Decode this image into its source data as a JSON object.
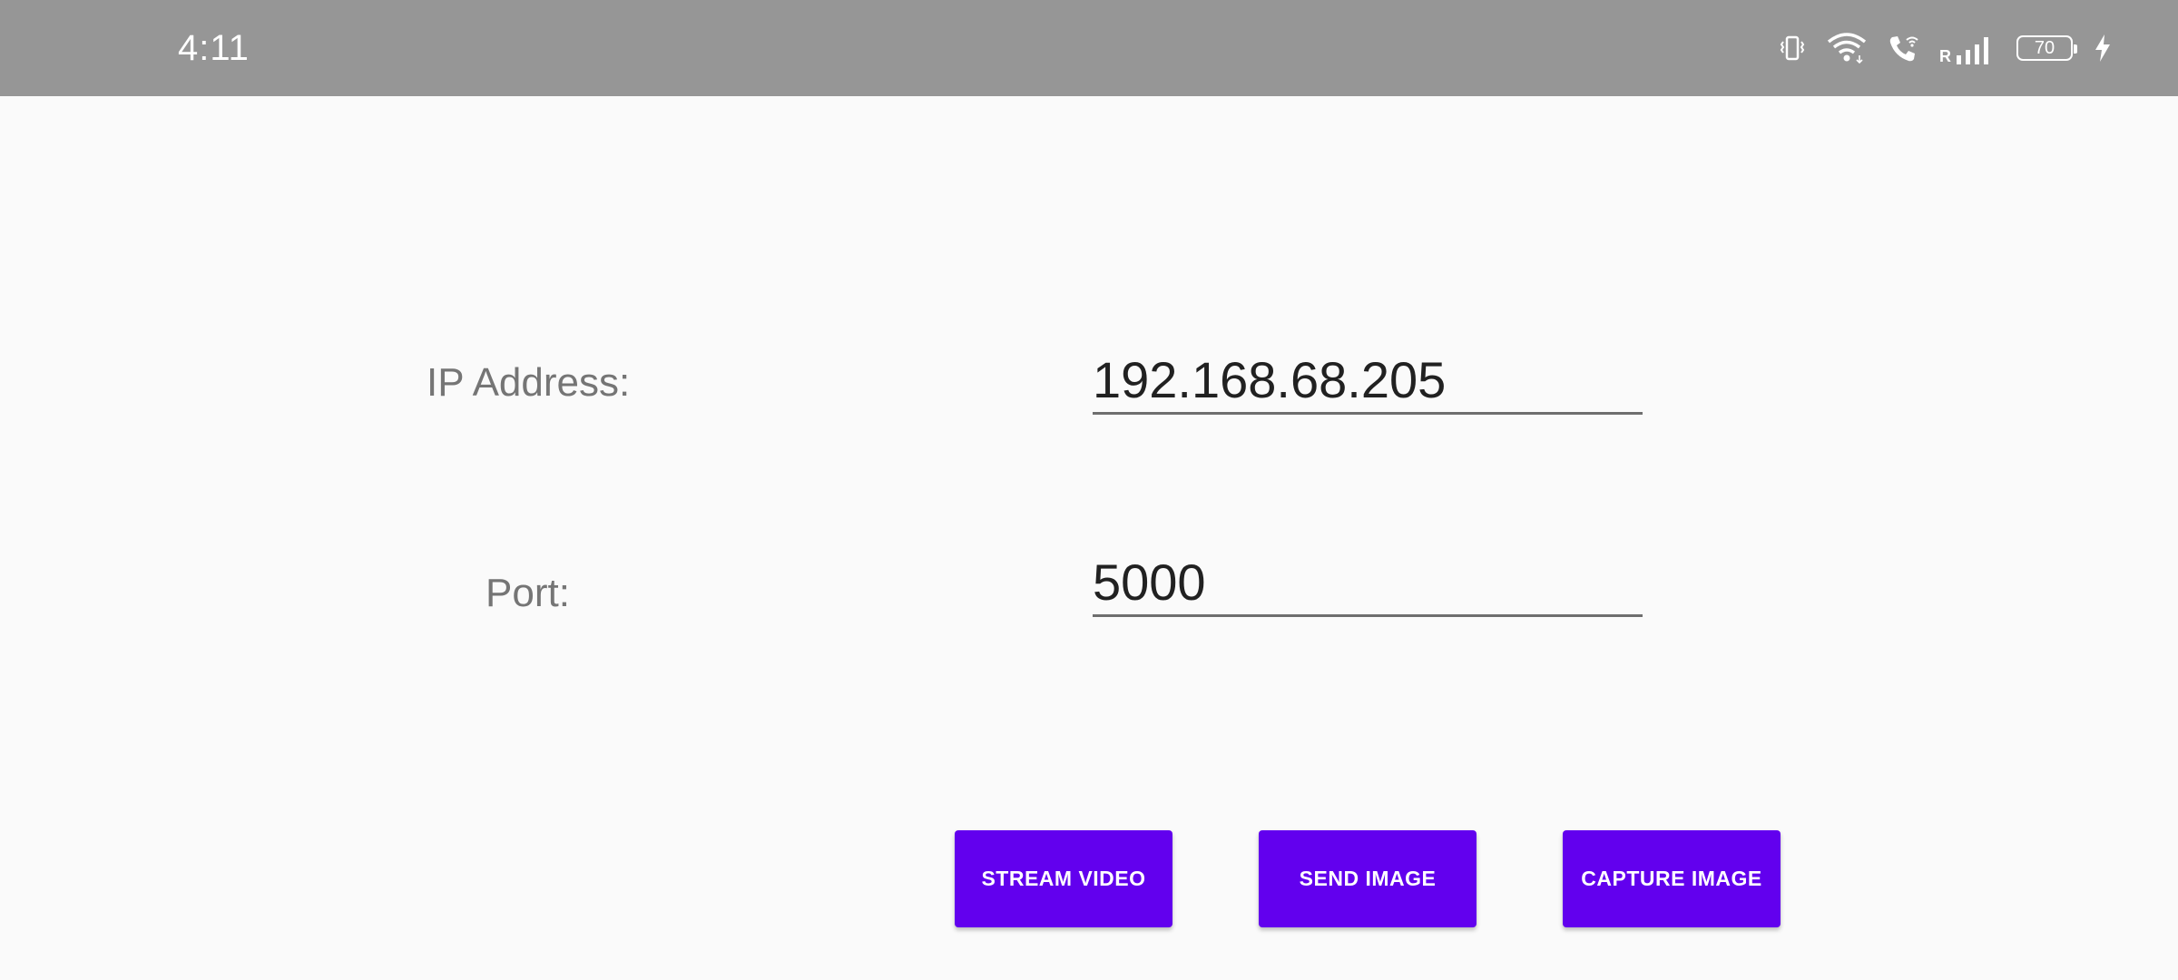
{
  "status_bar": {
    "time": "4:11",
    "icons": [
      "vibrate-icon",
      "wifi-icon",
      "wifi-calling-icon",
      "signal-icon",
      "battery-icon",
      "charging-icon"
    ],
    "roaming_indicator": "R",
    "battery_level": "70",
    "background_color": "#969696"
  },
  "form": {
    "ip_label": "IP Address:",
    "ip_value": "192.168.68.205",
    "port_label": "Port:",
    "port_value": "5000"
  },
  "buttons": {
    "stream_video": "STREAM VIDEO",
    "send_image": "SEND IMAGE",
    "capture_image": "CAPTURE IMAGE",
    "color": "#6200ee"
  }
}
